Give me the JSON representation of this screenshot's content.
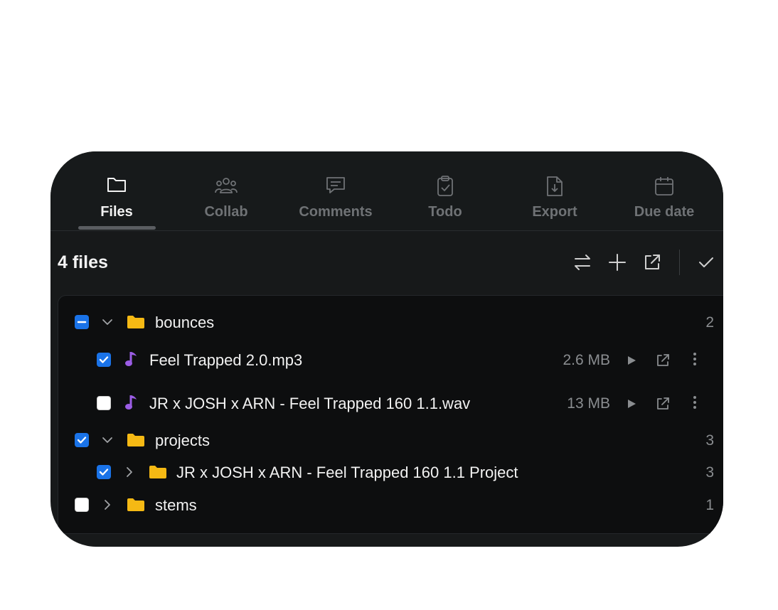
{
  "tabs": [
    {
      "label": "Files",
      "icon": "folder-icon",
      "active": true
    },
    {
      "label": "Collab",
      "icon": "users-icon",
      "active": false
    },
    {
      "label": "Comments",
      "icon": "comment-icon",
      "active": false
    },
    {
      "label": "Todo",
      "icon": "clipboard-check-icon",
      "active": false
    },
    {
      "label": "Export",
      "icon": "file-download-icon",
      "active": false
    },
    {
      "label": "Due date",
      "icon": "calendar-icon",
      "active": false
    }
  ],
  "header": {
    "files_count": "4 files"
  },
  "toolbar": [
    "swap-icon",
    "plus-icon",
    "external-link-icon",
    "check-icon"
  ],
  "tree": [
    {
      "type": "folder",
      "name": "bounces",
      "count": "2",
      "state": "partial",
      "expanded": true
    },
    {
      "type": "file",
      "name": "Feel Trapped 2.0.mp3",
      "size": "2.6 MB",
      "state": "checked"
    },
    {
      "type": "file",
      "name": "JR x JOSH x ARN - Feel Trapped 160 1.1.wav",
      "size": "13 MB",
      "state": "empty"
    },
    {
      "type": "folder",
      "name": "projects",
      "count": "3",
      "state": "checked",
      "expanded": true
    },
    {
      "type": "folder",
      "name": "JR x JOSH x ARN - Feel Trapped 160 1.1 Project",
      "count": "3",
      "state": "checked",
      "expanded": false
    },
    {
      "type": "folder",
      "name": "stems",
      "count": "1",
      "state": "empty",
      "expanded": false
    }
  ],
  "colors": {
    "accent": "#1a73e8",
    "folder": "#f5b914",
    "music": "#9b5de5",
    "panel": "#17191a"
  }
}
